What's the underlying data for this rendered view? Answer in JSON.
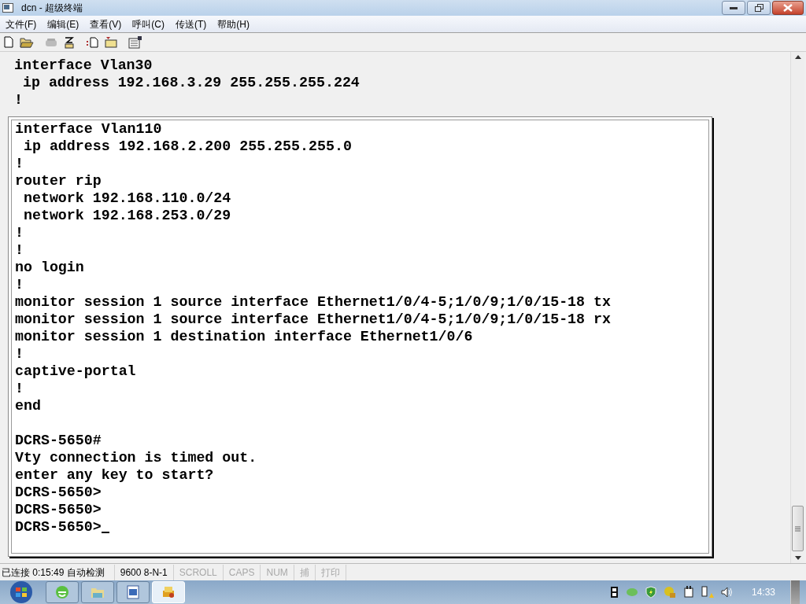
{
  "window": {
    "title": "dcn - 超级终端"
  },
  "menu": [
    "文件(F)",
    "编辑(E)",
    "查看(V)",
    "呼叫(C)",
    "传送(T)",
    "帮助(H)"
  ],
  "terminal": {
    "lines": [
      "interface Vlan30",
      " ip address 192.168.3.29 255.255.255.224",
      "!"
    ],
    "front_blocks": [
      [
        "interface Vlan110",
        " ip address 192.168.2.200 255.255.255.0",
        "!",
        "router rip",
        " network 192.168.110.0/24",
        " network 192.168.253.0/29",
        "!",
        "!",
        "no login",
        "!",
        "monitor session 1 source interface Ethernet1/0/4-5;1/0/9;1/0/15-18 tx",
        "monitor session 1 source interface Ethernet1/0/4-5;1/0/9;1/0/15-18 rx",
        "monitor session 1 destination interface Ethernet1/0/6",
        "!",
        "captive-portal",
        "!",
        "end"
      ],
      [
        "DCRS-5650#",
        "Vty connection is timed out.",
        "enter any key to start?",
        "DCRS-5650>",
        "DCRS-5650>",
        "DCRS-5650>"
      ]
    ]
  },
  "status_bar": [
    {
      "text": "已连接 0:15:49 自动检测",
      "on": true
    },
    {
      "text": "9600 8-N-1",
      "on": true
    },
    {
      "text": "SCROLL",
      "on": false
    },
    {
      "text": "CAPS",
      "on": false
    },
    {
      "text": "NUM",
      "on": false
    },
    {
      "text": "捕",
      "on": false
    },
    {
      "text": "打印",
      "on": false
    }
  ],
  "taskbar": {
    "buttons": [
      {
        "kind": "browser",
        "selected": false
      },
      {
        "kind": "folder",
        "selected": false
      },
      {
        "kind": "word",
        "selected": false
      },
      {
        "kind": "terminal",
        "selected": true
      }
    ],
    "clock": "14:33"
  }
}
